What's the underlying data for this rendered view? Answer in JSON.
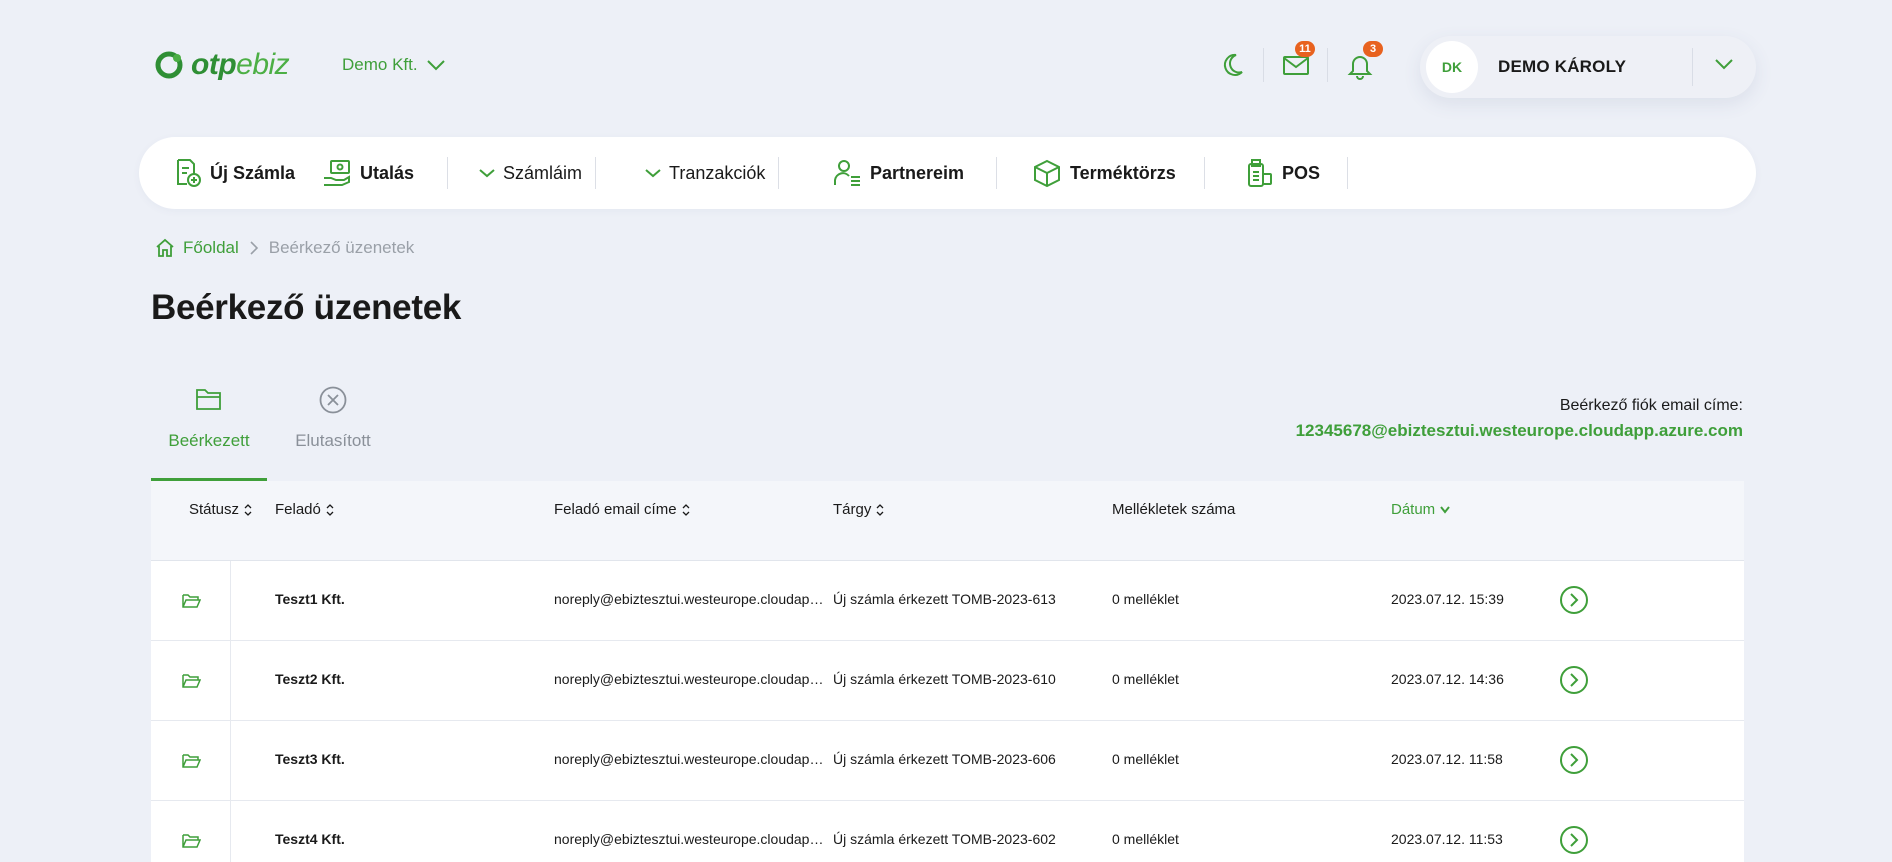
{
  "brand": {
    "logo_main": "otp",
    "logo_light": "ebiz"
  },
  "header": {
    "company": "Demo Kft.",
    "messages_badge": "11",
    "notifications_badge": "3",
    "user_initials": "DK",
    "user_name": "DEMO KÁROLY"
  },
  "nav": {
    "items": [
      {
        "label": "Új Számla"
      },
      {
        "label": "Utalás"
      },
      {
        "label": "Számláim"
      },
      {
        "label": "Tranzakciók"
      },
      {
        "label": "Partnereim"
      },
      {
        "label": "Terméktörzs"
      },
      {
        "label": "POS"
      }
    ]
  },
  "breadcrumb": {
    "home": "Főoldal",
    "current": "Beérkező üzenetek"
  },
  "page": {
    "title": "Beérkező üzenetek"
  },
  "tabs": [
    {
      "label": "Beérkezett",
      "active": true
    },
    {
      "label": "Elutasított",
      "active": false
    }
  ],
  "inbox": {
    "label": "Beérkező fiók email címe:",
    "email": "12345678@ebiztesztui.westeurope.cloudapp.azure.com"
  },
  "table": {
    "columns": [
      "Státusz",
      "Feladó",
      "Feladó email címe",
      "Tárgy",
      "Mellékletek száma",
      "Dátum"
    ],
    "sorted_column": "Dátum",
    "rows": [
      {
        "sender": "Teszt1 Kft.",
        "email": "noreply@ebiztesztui.westeurope.cloudapp.azure.com",
        "subject": "Új számla érkezett TOMB-2023-613",
        "attachments": "0 melléklet",
        "date": "2023.07.12. 15:39"
      },
      {
        "sender": "Teszt2 Kft.",
        "email": "noreply@ebiztesztui.westeurope.cloudapp.azure.com",
        "subject": "Új számla érkezett TOMB-2023-610",
        "attachments": "0 melléklet",
        "date": "2023.07.12. 14:36"
      },
      {
        "sender": "Teszt3 Kft.",
        "email": "noreply@ebiztesztui.westeurope.cloudapp.azure.com",
        "subject": "Új számla érkezett TOMB-2023-606",
        "attachments": "0 melléklet",
        "date": "2023.07.12. 11:58"
      },
      {
        "sender": "Teszt4 Kft.",
        "email": "noreply@ebiztesztui.westeurope.cloudapp.azure.com",
        "subject": "Új számla érkezett TOMB-2023-602",
        "attachments": "0 melléklet",
        "date": "2023.07.12. 11:53"
      }
    ]
  },
  "colors": {
    "accent": "#3f9f3a",
    "badge": "#e8621f",
    "background": "#edf0f7"
  }
}
